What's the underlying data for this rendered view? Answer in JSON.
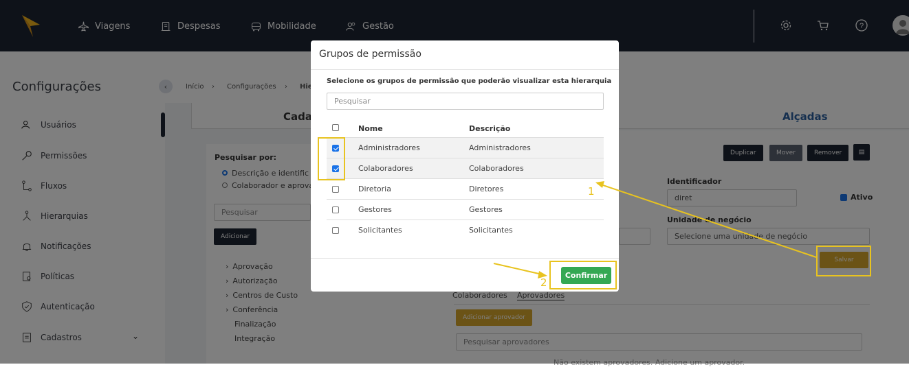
{
  "nav": {
    "items": [
      {
        "label": "Viagens",
        "icon": "airplane-icon"
      },
      {
        "label": "Despesas",
        "icon": "receipt-icon"
      },
      {
        "label": "Mobilidade",
        "icon": "car-icon"
      },
      {
        "label": "Gestão",
        "icon": "users-icon"
      }
    ]
  },
  "sidebar": {
    "title": "Configurações",
    "items": [
      {
        "label": "Usuários",
        "icon": "users-icon"
      },
      {
        "label": "Permissões",
        "icon": "key-icon"
      },
      {
        "label": "Fluxos",
        "icon": "flow-icon"
      },
      {
        "label": "Hierarquias",
        "icon": "hierarchy-icon"
      },
      {
        "label": "Notificações",
        "icon": "bell-icon"
      },
      {
        "label": "Políticas",
        "icon": "policy-icon"
      },
      {
        "label": "Autenticação",
        "icon": "shield-icon"
      },
      {
        "label": "Cadastros",
        "icon": "document-icon"
      }
    ]
  },
  "breadcrumb": {
    "items": [
      "Início",
      "Configurações",
      "Hie"
    ]
  },
  "tabs": {
    "left": "Cada",
    "right": "Alçadas"
  },
  "left_panel": {
    "search_by_label": "Pesquisar por:",
    "radio_1": "Descrição e identific",
    "radio_2": "Colaborador e aprova",
    "search_placeholder": "Pesquisar",
    "add_button": "Adicionar",
    "tree": [
      "Aprovação",
      "Autorização",
      "Centros de Custo",
      "Conferência",
      "Finalização",
      "Integração"
    ]
  },
  "right_panel": {
    "duplicate": "Duplicar",
    "move": "Mover",
    "remove": "Remover",
    "identifier_label": "Identificador",
    "identifier_value": "diret",
    "active_label": "Ativo",
    "business_unit_label": "Unidade de negócio",
    "business_unit_placeholder": "Selecione uma unidade de negócio",
    "save": "Salvar",
    "tab_collaborators": "Colaboradores",
    "tab_approvers": "Aprovadores",
    "add_approver": "Adicionar aprovador",
    "search_approvers": "Pesquisar aprovadores",
    "empty_text": "Não existem aprovadores. Adicione um aprovador."
  },
  "modal": {
    "title": "Grupos de permissão",
    "instruction": "Selecione os grupos de permissão que poderão visualizar esta hierarquia",
    "search_placeholder": "Pesquisar",
    "col_name": "Nome",
    "col_desc": "Descrição",
    "rows": [
      {
        "name": "Administradores",
        "desc": "Administradores",
        "checked": true
      },
      {
        "name": "Colaboradores",
        "desc": "Colaboradores",
        "checked": true
      },
      {
        "name": "Diretoria",
        "desc": "Diretores",
        "checked": false
      },
      {
        "name": "Gestores",
        "desc": "Gestores",
        "checked": false
      },
      {
        "name": "Solicitantes",
        "desc": "Solicitantes",
        "checked": false
      }
    ],
    "confirm": "Confirmar"
  },
  "annotations": {
    "a1": "1",
    "a2": "2",
    "color": "#e8c31f"
  }
}
